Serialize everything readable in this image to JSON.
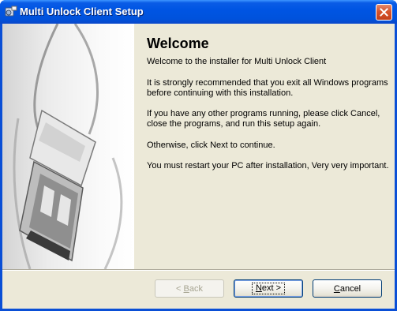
{
  "window": {
    "title": "Multi Unlock Client Setup",
    "icon": "setup-installer-icon"
  },
  "content": {
    "heading": "Welcome",
    "paragraphs": [
      "Welcome to the installer for Multi Unlock Client",
      "It is strongly recommended that you exit all Windows programs before continuing with this installation.",
      "If you have any other programs running, please click Cancel, close the programs, and run this setup again.",
      "Otherwise, click Next to continue.",
      "You must restart your PC after installation, Very very important."
    ]
  },
  "buttons": {
    "back": {
      "prefix": "< ",
      "accel": "B",
      "rest": "ack",
      "enabled": false
    },
    "next": {
      "accel": "N",
      "rest": "ext",
      "suffix": " >"
    },
    "cancel": {
      "accel": "C",
      "rest": "ancel"
    }
  },
  "colors": {
    "titlebar": "#0055e3",
    "dialog_background": "#ece9d8",
    "close_button": "#d7542c"
  }
}
